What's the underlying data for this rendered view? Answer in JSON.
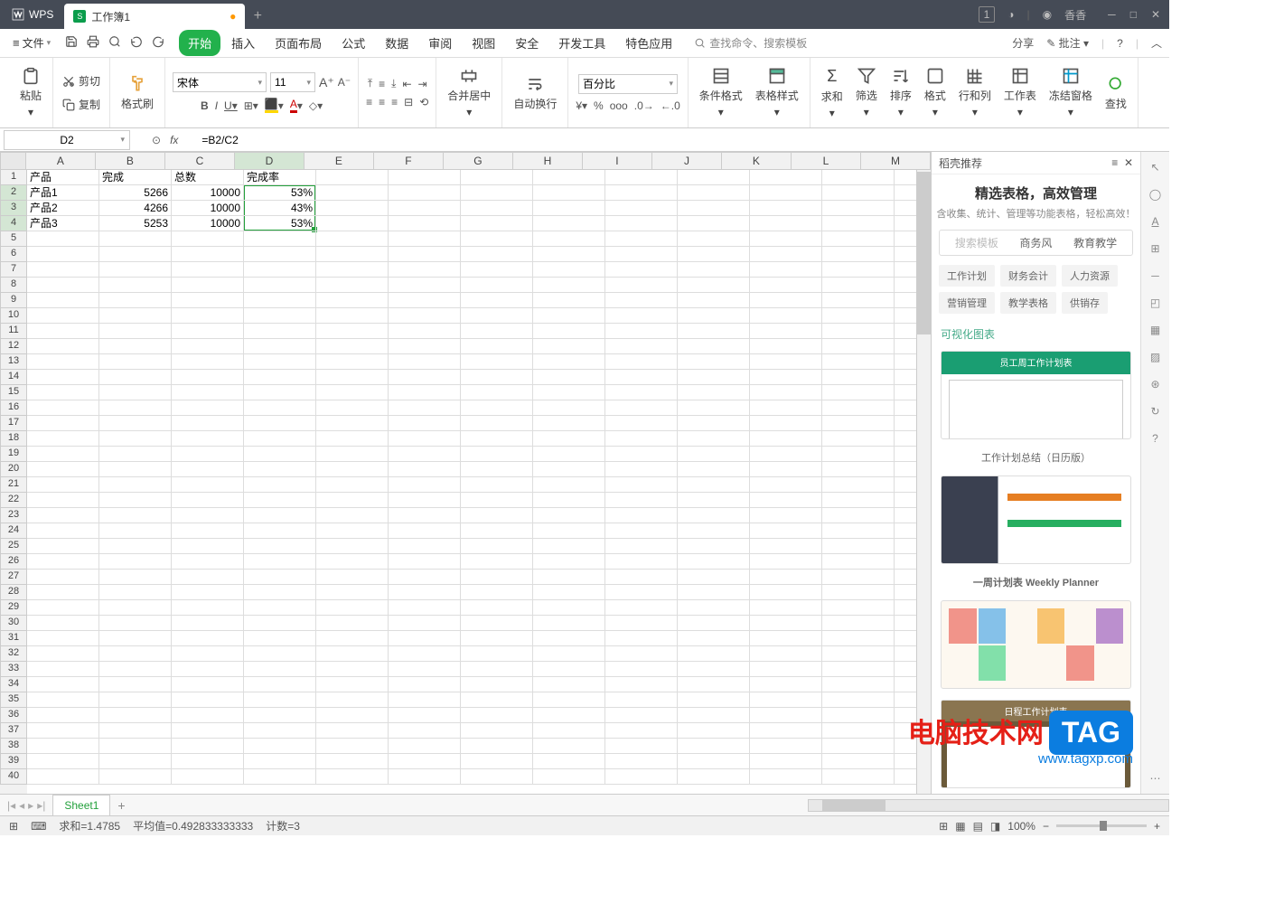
{
  "titlebar": {
    "app": "WPS",
    "doc_tab": "工作簿1",
    "badge": "1",
    "user": "香香"
  },
  "file_label": "文件",
  "menus": [
    "开始",
    "插入",
    "页面布局",
    "公式",
    "数据",
    "审阅",
    "视图",
    "安全",
    "开发工具",
    "特色应用"
  ],
  "search_placeholder": "查找命令、搜索模板",
  "share": "分享",
  "annotate": "批注",
  "ribbon": {
    "paste": "粘贴",
    "cut": "剪切",
    "copy": "复制",
    "format_painter": "格式刷",
    "font": "宋体",
    "font_size": "11",
    "merge": "合并居中",
    "wrap": "自动换行",
    "number_format": "百分比",
    "cond_format": "条件格式",
    "cell_style": "表格样式",
    "sum": "求和",
    "filter": "筛选",
    "sort": "排序",
    "format": "格式",
    "rows_cols": "行和列",
    "sheet": "工作表",
    "freeze": "冻结窗格",
    "find": "查找"
  },
  "name_box": "D2",
  "formula": "=B2/C2",
  "columns": [
    "A",
    "B",
    "C",
    "D",
    "E",
    "F",
    "G",
    "H",
    "I",
    "J",
    "K",
    "L",
    "M"
  ],
  "headers": {
    "A": "产品",
    "B": "完成",
    "C": "总数",
    "D": "完成率"
  },
  "rows": [
    {
      "A": "产品1",
      "B": "5266",
      "C": "10000",
      "D": "53%"
    },
    {
      "A": "产品2",
      "B": "4266",
      "C": "10000",
      "D": "43%"
    },
    {
      "A": "产品3",
      "B": "5253",
      "C": "10000",
      "D": "53%"
    }
  ],
  "right_panel": {
    "header": "稻壳推荐",
    "title": "精选表格，高效管理",
    "subtitle": "含收集、统计、管理等功能表格，轻松高效！",
    "tabs": [
      "搜索模板",
      "商务风",
      "教育教学"
    ],
    "cats": [
      "工作计划",
      "财务会计",
      "人力资源",
      "营销管理",
      "教学表格",
      "供销存"
    ],
    "label": "可视化图表",
    "templates": [
      "员工周工作计划表",
      "工作计划总结（日历版）",
      "一周计划表 Weekly Planner",
      "日程工作计划表"
    ]
  },
  "sheet_tab": "Sheet1",
  "status": {
    "sum": "求和=1.4785",
    "avg": "平均值=0.492833333333",
    "count": "计数=3",
    "zoom": "100%"
  },
  "watermark": {
    "text": "电脑技术网",
    "tag": "TAG",
    "url": "www.tagxp.com"
  }
}
